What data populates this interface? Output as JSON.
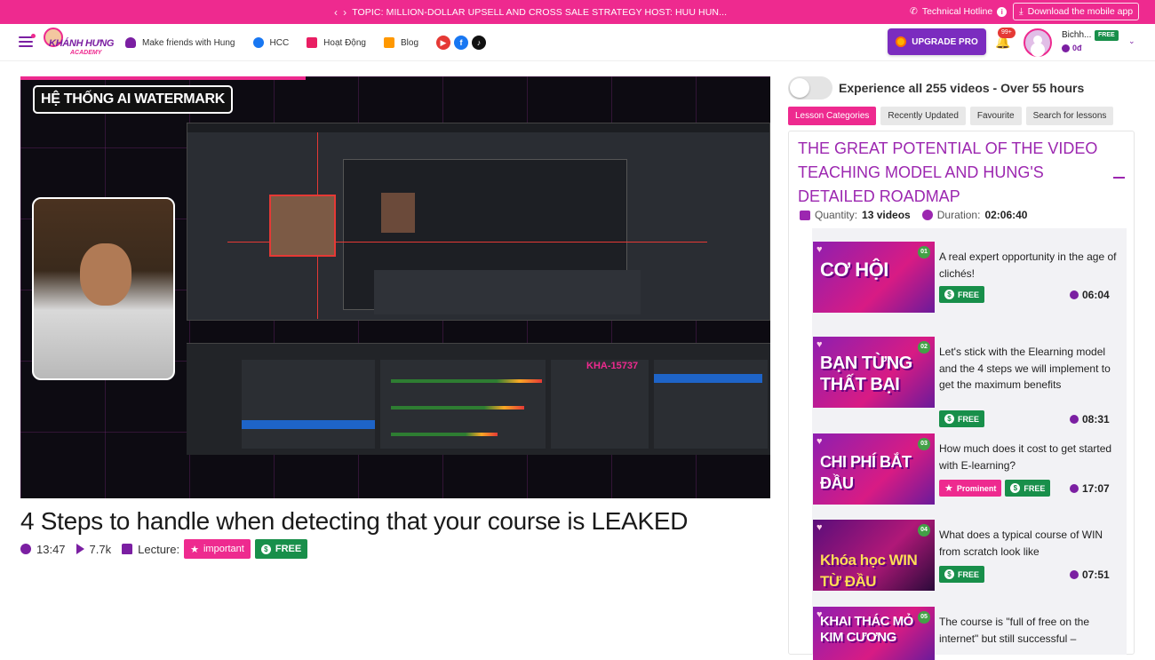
{
  "topbar": {
    "topic": "TOPIC: MILLION-DOLLAR UPSELL AND CROSS SALE STRATEGY HOST: HUU HUN...",
    "hotline": "Technical Hotline",
    "download": "Download the mobile app"
  },
  "header": {
    "logo_line1": "KHÁNH HƯNG",
    "logo_line2": "ACADEMY",
    "nav": [
      "Make friends with Hung",
      "HCC",
      "Hoạt Động",
      "Blog"
    ],
    "upgrade": "UPGRADE PRO",
    "notifications": "99+",
    "username": "Bichh...",
    "plan": "FREE",
    "balance": "0đ"
  },
  "video": {
    "watermark_title": "HỆ THỐNG AI WATERMARK",
    "overlay_code": "KHA-15737",
    "progress": 0.38,
    "title": "4 Steps to handle when detecting that your course is LEAKED",
    "duration": "13:47",
    "views": "7.7k",
    "lecture_label": "Lecture:",
    "tag_important": "important",
    "tag_free": "FREE"
  },
  "sidebar": {
    "experience": "Experience all 255 videos - Over 55 hours",
    "tabs": [
      "Lesson Categories",
      "Recently Updated",
      "Favourite",
      "Search for lessons"
    ],
    "category": {
      "title": "THE GREAT POTENTIAL OF THE VIDEO TEACHING MODEL AND HUNG'S DETAILED ROADMAP",
      "quantity_label": "Quantity:",
      "quantity": "13 videos",
      "duration_label": "Duration:",
      "duration": "02:06:40"
    },
    "lessons": [
      {
        "num": "01",
        "thumb": "CƠ HỘI",
        "title": "A real expert opportunity in the age of clichés!",
        "free": "FREE",
        "promo": "",
        "duration": "06:04"
      },
      {
        "num": "02",
        "thumb": "BẠN TỪNG THẤT BẠI",
        "title": "Let's stick with the Elearning model and the 4 steps we will implement to get the maximum benefits",
        "free": "FREE",
        "promo": "",
        "duration": "08:31"
      },
      {
        "num": "03",
        "thumb": "CHI PHÍ BẮT ĐẦU",
        "title": "How much does it cost to get started with E-learning?",
        "free": "FREE",
        "promo": "Prominent",
        "duration": "17:07"
      },
      {
        "num": "04",
        "thumb": "Khóa học WIN TỪ ĐẦU",
        "title": "What does a typical course of WIN from scratch look like",
        "free": "FREE",
        "promo": "",
        "duration": "07:51"
      },
      {
        "num": "05",
        "thumb": "KHAI THÁC MỎ KIM CƯƠNG",
        "title": "The course is \"full of free on the internet\" but still successful –",
        "free": "",
        "promo": "",
        "duration": ""
      }
    ]
  }
}
